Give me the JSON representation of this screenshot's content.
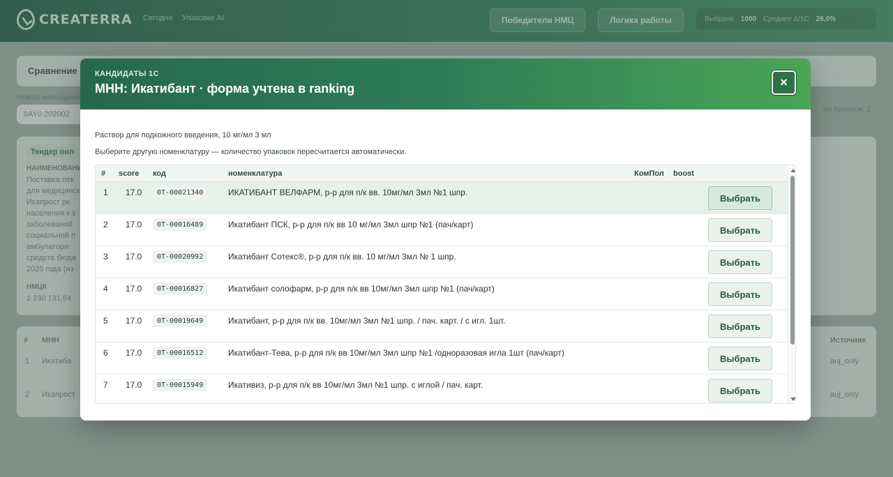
{
  "app": {
    "logo_text": "CREATERRA",
    "nav_links": [
      "Сегодня",
      "Упаковки AI"
    ],
    "top_buttons": [
      "Победители НМЦ",
      "Логика работы"
    ],
    "stats": {
      "label1": "Выбрано",
      "value1": "1000",
      "label2": "Среднее Δ/1С",
      "value2": "26,0%"
    }
  },
  "background": {
    "tab_label": "Сравнение",
    "field_label": "Номер извещения",
    "field_value": "0AY0.202002",
    "card_tag": "Тендер онл",
    "section_label": "НАИМЕНОВАНИЕ",
    "body_lines": [
      "Поставка лек",
      "для медицинск",
      "Икапрост ре",
      "населения к з",
      "заболеваний",
      "социальной п",
      "амбулаторн",
      "средств бюдж",
      "2025 года (из"
    ],
    "price_label": "НМЦК",
    "price_value": "1 230 131,64",
    "status_text": "на проверк: 2",
    "table_hash": "#",
    "table_col": "МНН",
    "table_col_right": "Источник",
    "table_rows": [
      {
        "n": "1",
        "name": "Икатиба",
        "src": "auj_only"
      },
      {
        "n": "2",
        "name": "Икапрост",
        "src": "auj_only"
      }
    ]
  },
  "modal": {
    "kicker": "КАНДИДАТЫ 1С",
    "title": "МНН: Икатибант · форма учтена в ranking",
    "close_glyph": "×",
    "subtitle": "Раствор для подкожного введения, 10 мг/мл 3 мл",
    "hint": "Выберите другую номенклатуру — количество упаковок пересчитается автоматически.",
    "columns": {
      "num": "#",
      "score": "score",
      "code": "код",
      "name": "номенклатура",
      "kompol": "КомПол",
      "boost": "boost"
    },
    "select_label": "Выбрать",
    "rows": [
      {
        "num": "1",
        "score": "17.0",
        "code": "0T-00021340",
        "name": "ИКАТИБАНТ ВЕЛФАРМ, р-р для п/к вв. 10мг/мл 3мл №1  шпр.",
        "selected": true
      },
      {
        "num": "2",
        "score": "17.0",
        "code": "0T-00016489",
        "name": "Икатибант ПСК, р-р для п/к вв 10 мг/мл 3мл шпр №1 (пач/карт)",
        "selected": false
      },
      {
        "num": "3",
        "score": "17.0",
        "code": "0T-00020992",
        "name": "Икатибант Сотекс®, р-р для п/к вв. 10 мг/мл 3мл № 1 шпр.",
        "selected": false
      },
      {
        "num": "4",
        "score": "17.0",
        "code": "0T-00016827",
        "name": "Икатибант солофарм, р-р для п/к вв 10мг/мл 3мл шпр №1 (пач/карт)",
        "selected": false
      },
      {
        "num": "5",
        "score": "17.0",
        "code": "0T-00019649",
        "name": "Икатибант, р-р для п/к вв. 10мг/мл 3мл №1 шпр. / пач. карт. / с игл. 1шт.",
        "selected": false
      },
      {
        "num": "6",
        "score": "17.0",
        "code": "0T-00016512",
        "name": "Икатибант-Тева, р-р для п/к вв 10мг/мл 3мл шпр №1 /одноразовая игла 1шт (пач/карт)",
        "selected": false
      },
      {
        "num": "7",
        "score": "17.0",
        "code": "0T-00015949",
        "name": "Икативиз, р-р для п/к вв 10мг/мл 3мл №1 шпр. с иглой / пач. карт.",
        "selected": false
      }
    ]
  }
}
